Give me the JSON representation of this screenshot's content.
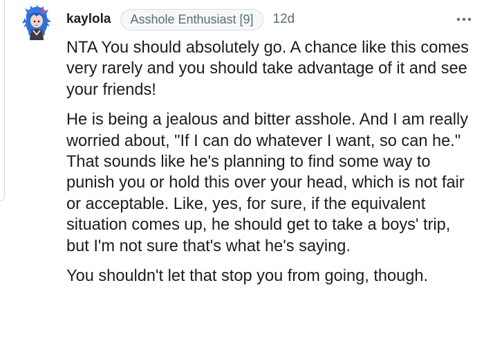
{
  "comment": {
    "username": "kaylola",
    "flair": "Asshole Enthusiast [9]",
    "timestamp": "12d",
    "more_icon": "more-horizontal-icon",
    "paragraphs": [
      "NTA You should absolutely go. A chance like this comes very rarely and you should take advantage of it and see your friends!",
      "He is being a jealous and bitter asshole. And I am really worried about, \"If I can do whatever I want, so can he.\" That sounds like he's planning to find some way to punish you or hold this over your head, which is not fair or acceptable. Like, yes, for sure, if the equivalent situation comes up, he should get to take a boys' trip, but I'm not sure that's what he's saying.",
      "You shouldn't let that stop you from going, though."
    ]
  },
  "colors": {
    "text": "#1c1c1c",
    "meta": "#576f76",
    "flair_bg": "#f6f7f8",
    "thread_line": "#d0d3d6",
    "avatar_hair": "#2f6fd6",
    "avatar_skin": "#f3d7c8"
  }
}
